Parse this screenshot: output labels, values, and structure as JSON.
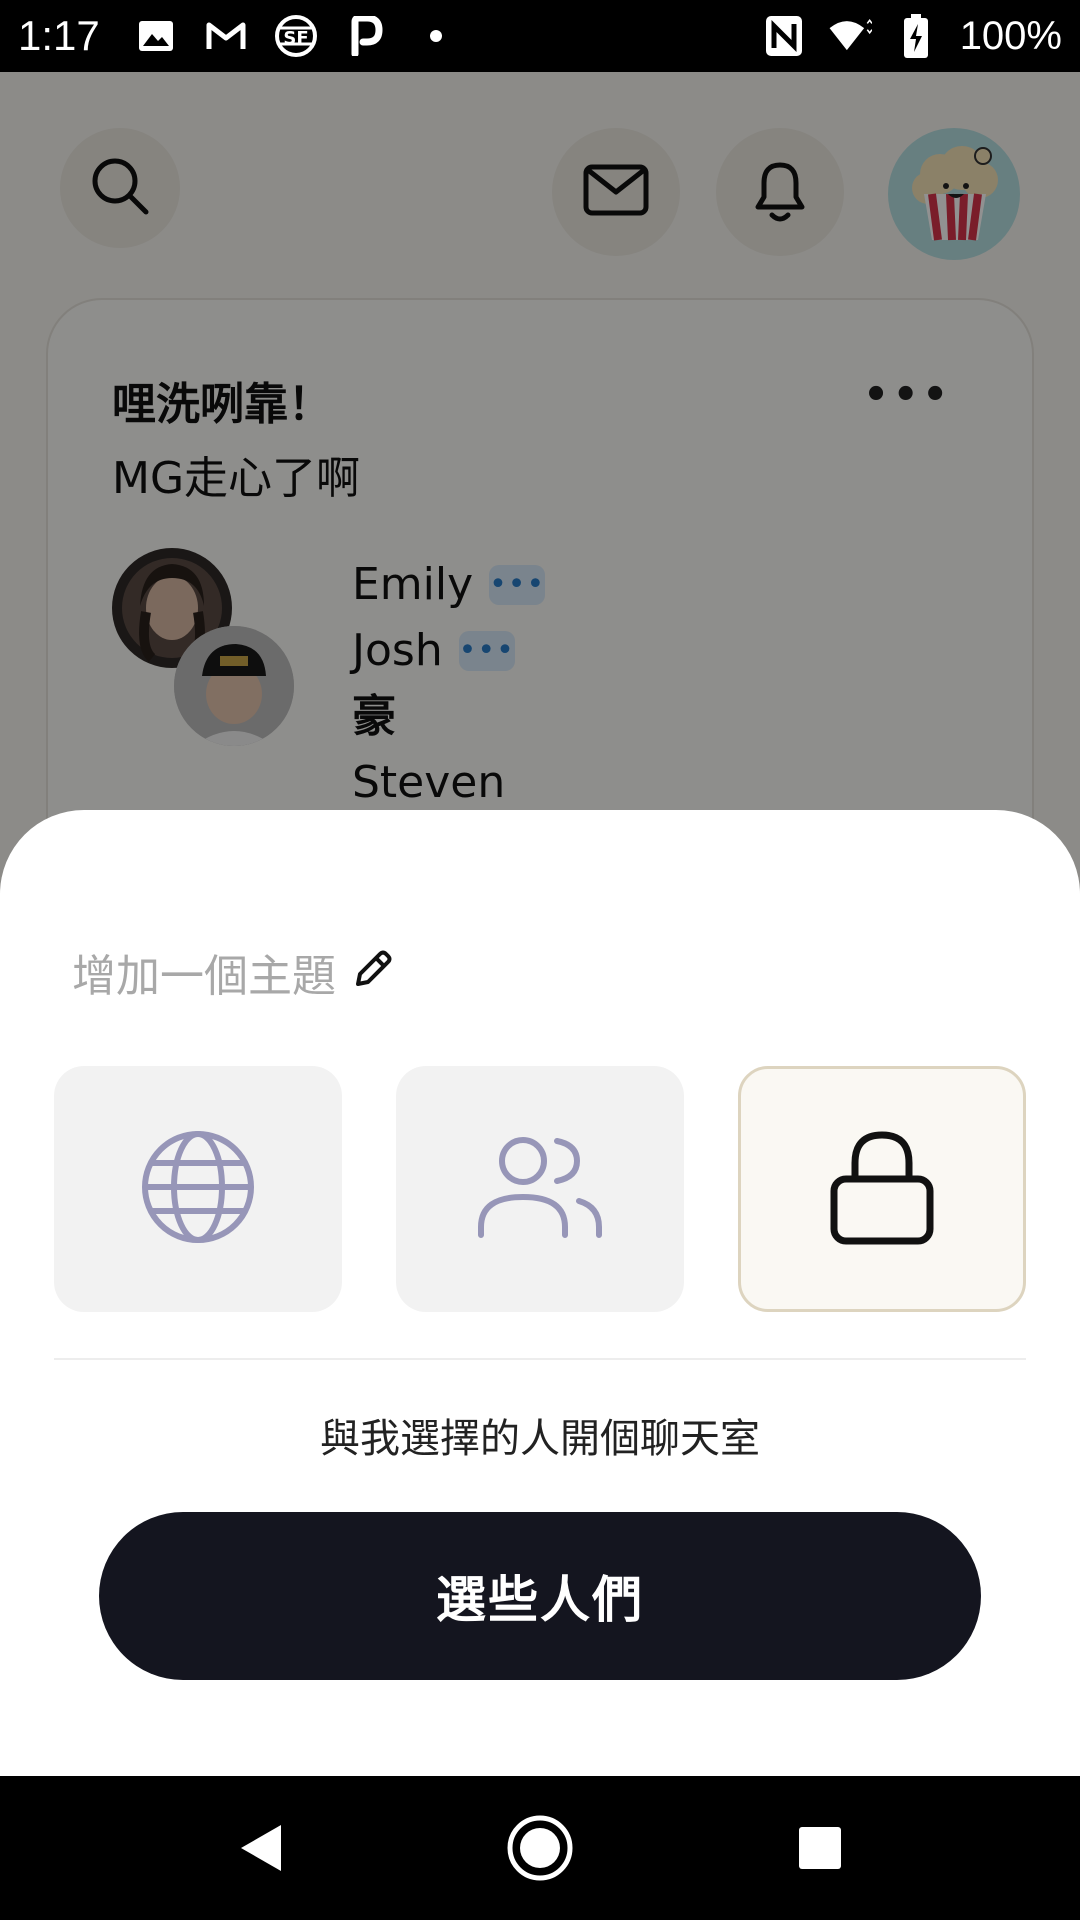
{
  "status_bar": {
    "time": "1:17",
    "battery_percent": "100%",
    "left_icons": [
      "image-icon",
      "gmail-icon",
      "sf-icon",
      "p-icon",
      "dot-icon"
    ],
    "right_icons": [
      "nfc-icon",
      "wifi-icon",
      "battery-charging-icon"
    ]
  },
  "background": {
    "room": {
      "title_line1": "哩洗咧靠！",
      "title_line2": "MG走心了啊",
      "more_label": "•••",
      "speakers": [
        {
          "name": "Emily",
          "speaking": true
        },
        {
          "name": "Josh",
          "speaking": true
        },
        {
          "name": "豪",
          "speaking": false
        },
        {
          "name": "Steven",
          "speaking": false
        }
      ],
      "bubble_glyph": "•••"
    }
  },
  "sheet": {
    "topic_placeholder": "增加一個主題",
    "room_types": [
      {
        "icon": "globe-icon",
        "selected": false
      },
      {
        "icon": "people-icon",
        "selected": false
      },
      {
        "icon": "lock-icon",
        "selected": true
      }
    ],
    "description": "與我選擇的人開個聊天室",
    "button_label": "選些人們"
  },
  "colors": {
    "button_bg": "#14151f",
    "selected_border": "#ddd4bf",
    "icon_muted": "#9796b8",
    "avatar_bg": "#b6dfe1"
  }
}
